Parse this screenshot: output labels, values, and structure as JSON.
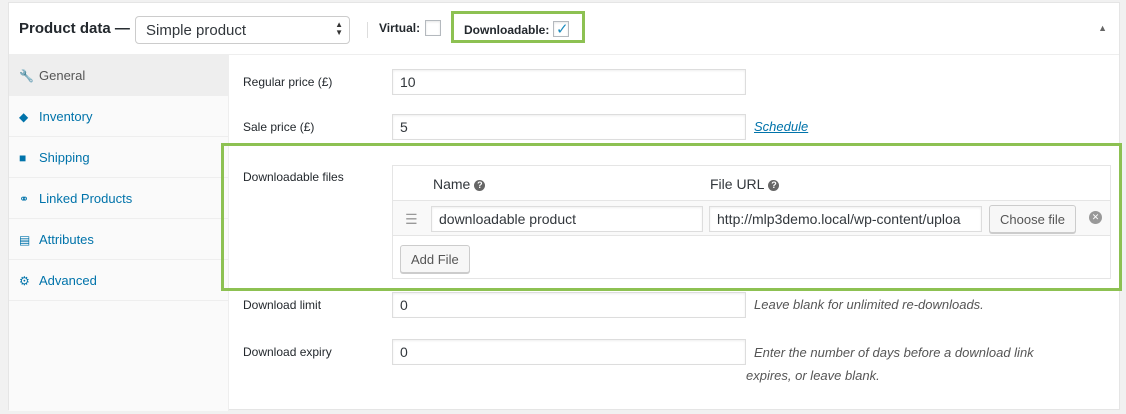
{
  "header": {
    "title": "Product data —",
    "product_type": "Simple product",
    "virtual_label": "Virtual:",
    "downloadable_label": "Downloadable:"
  },
  "icons": {
    "general": "wrench-icon",
    "inventory": "tag-icon",
    "shipping": "truck-icon",
    "linked_products": "link-icon",
    "attributes": "list-icon",
    "advanced": "gear-icon"
  },
  "sidebar": {
    "items": [
      {
        "label": "General",
        "active": true
      },
      {
        "label": "Inventory"
      },
      {
        "label": "Shipping"
      },
      {
        "label": "Linked Products"
      },
      {
        "label": "Attributes"
      },
      {
        "label": "Advanced"
      }
    ]
  },
  "pricing": {
    "regular_price_label": "Regular price (£)",
    "regular_price_value": "10",
    "sale_price_label": "Sale price (£)",
    "sale_price_value": "5",
    "schedule_link": "Schedule"
  },
  "downloadable_files": {
    "label": "Downloadable files",
    "col_name": "Name",
    "col_url": "File URL",
    "file_name": "downloadable product",
    "file_url": "http://mlp3demo.local/wp-content/uploa",
    "choose_file": "Choose file",
    "add_file": "Add File"
  },
  "download_limit": {
    "label": "Download limit",
    "value": "0",
    "desc": "Leave blank for unlimited re-downloads."
  },
  "download_expiry": {
    "label": "Download expiry",
    "value": "0",
    "desc": "Enter the number of days before a download link expires, or leave blank."
  },
  "colors": {
    "highlight": "#8dc152",
    "link": "#0073aa"
  }
}
